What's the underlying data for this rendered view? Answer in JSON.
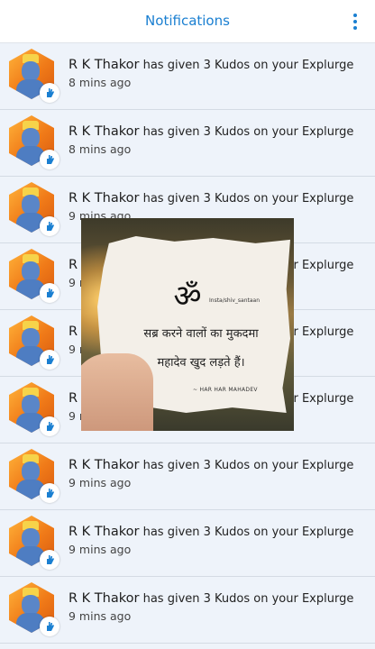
{
  "header": {
    "title": "Notifications",
    "menu_icon": "more-vertical-icon",
    "accent_color": "#1a7fd1"
  },
  "notifications": [
    {
      "name": "R K Thakor",
      "message": "has given 3 Kudos on your Explurge",
      "time": "8 mins ago"
    },
    {
      "name": "R K Thakor",
      "message": "has given 3 Kudos on your Explurge",
      "time": "8 mins ago"
    },
    {
      "name": "R K Thakor",
      "message": "has given 3 Kudos on your Explurge",
      "time": "9 mins ago"
    },
    {
      "name": "R K Thakor",
      "message": "has given 3 Kudos on your Explurge",
      "time": "9 mins ago"
    },
    {
      "name": "R K Thakor",
      "message": "has given 3 Kudos on your Explurge",
      "time": "9 mins ago"
    },
    {
      "name": "R K Thakor",
      "message": "has given 3 Kudos on your Explurge",
      "time": "9 mins ago"
    },
    {
      "name": "R K Thakor",
      "message": "has given 3 Kudos on your Explurge",
      "time": "9 mins ago"
    },
    {
      "name": "R K Thakor",
      "message": "has given 3 Kudos on your Explurge",
      "time": "9 mins ago"
    },
    {
      "name": "R K Thakor",
      "message": "has given 3 Kudos on your Explurge",
      "time": "9 mins ago"
    }
  ],
  "overlay": {
    "om": "ॐ",
    "handle": "Insta/shiv_santaan",
    "quote_line1": "सब्र करने वालों का मुकदमा",
    "quote_line2": "महादेव खुद लड़ते हैं।",
    "signature": "~ HAR HAR MAHADEV"
  }
}
